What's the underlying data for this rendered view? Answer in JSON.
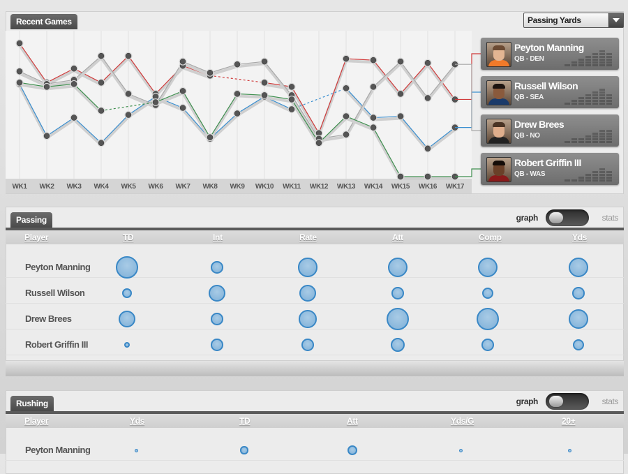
{
  "recent_games": {
    "title": "Recent Games",
    "stat_select": {
      "selected": "Passing Yards"
    },
    "weeks": [
      "WK1",
      "WK2",
      "WK3",
      "WK4",
      "WK5",
      "WK6",
      "WK7",
      "WK8",
      "WK9",
      "WK10",
      "WK11",
      "WK12",
      "WK13",
      "WK14",
      "WK15",
      "WK16",
      "WK17"
    ],
    "colors": {
      "manning": "#d03a3a",
      "wilson": "#3a8fd0",
      "brees": "#a8a8a8",
      "griffin": "#3f8f4f"
    },
    "players": [
      {
        "name": "Peyton Manning",
        "team": "QB - DEN",
        "icon": "player-photo-icon"
      },
      {
        "name": "Russell Wilson",
        "team": "QB - SEA",
        "icon": "player-photo-icon"
      },
      {
        "name": "Drew Brees",
        "team": "QB - NO",
        "icon": "player-photo-icon"
      },
      {
        "name": "Robert Griffin III",
        "team": "QB - WAS",
        "icon": "player-photo-icon"
      }
    ]
  },
  "chart_data": {
    "type": "line",
    "categories": [
      "WK1",
      "WK2",
      "WK3",
      "WK4",
      "WK5",
      "WK6",
      "WK7",
      "WK8",
      "WK9",
      "WK10",
      "WK11",
      "WK12",
      "WK13",
      "WK14",
      "WK15",
      "WK16",
      "WK17"
    ],
    "ylim": [
      0,
      1
    ],
    "series": [
      {
        "name": "Peyton Manning",
        "values": [
          0.95,
          0.67,
          0.77,
          0.67,
          0.86,
          0.59,
          0.79,
          0.72,
          null,
          0.67,
          0.64,
          0.31,
          0.84,
          0.83,
          0.59,
          0.81,
          0.55
        ]
      },
      {
        "name": "Russell Wilson",
        "values": [
          0.66,
          0.29,
          0.42,
          0.24,
          0.44,
          0.57,
          0.49,
          0.27,
          0.45,
          0.57,
          0.48,
          null,
          0.63,
          0.42,
          0.43,
          0.2,
          0.35
        ]
      },
      {
        "name": "Drew Brees",
        "values": [
          0.75,
          0.66,
          0.69,
          0.86,
          0.59,
          0.51,
          0.82,
          0.74,
          0.8,
          0.82,
          0.58,
          0.27,
          0.3,
          0.64,
          0.82,
          0.56,
          0.8
        ]
      },
      {
        "name": "Robert Griffin III",
        "values": [
          0.67,
          0.64,
          0.66,
          0.47,
          null,
          0.53,
          0.61,
          0.28,
          0.59,
          0.58,
          0.55,
          0.24,
          0.43,
          0.35,
          0.0,
          0.0,
          0.0
        ]
      }
    ],
    "dashed_segments": [
      {
        "series": "Peyton Manning",
        "from": "WK8",
        "to": "WK10"
      },
      {
        "series": "Russell Wilson",
        "from": "WK11",
        "to": "WK13"
      },
      {
        "series": "Robert Griffin III",
        "from": "WK4",
        "to": "WK6"
      }
    ]
  },
  "passing": {
    "title": "Passing",
    "toggle": {
      "left": "graph",
      "right": "stats",
      "selected": "graph"
    },
    "columns": [
      "Player",
      "TD",
      "Int",
      "Rate",
      "Att",
      "Comp",
      "Yds"
    ],
    "rows": [
      {
        "player": "Peyton Manning",
        "values": [
          1.0,
          0.55,
          0.85,
          0.9,
          0.9,
          0.9
        ]
      },
      {
        "player": "Russell Wilson",
        "values": [
          0.45,
          0.75,
          0.75,
          0.55,
          0.5,
          0.55
        ]
      },
      {
        "player": "Drew Brees",
        "values": [
          0.75,
          0.55,
          0.8,
          1.0,
          1.0,
          0.9
        ]
      },
      {
        "player": "Robert Griffin III",
        "values": [
          0.25,
          0.55,
          0.55,
          0.65,
          0.55,
          0.5
        ]
      }
    ]
  },
  "rushing": {
    "title": "Rushing",
    "toggle": {
      "left": "graph",
      "right": "stats",
      "selected": "graph"
    },
    "columns": [
      "Player",
      "Yds",
      "TD",
      "Att",
      "Yds/G",
      "20+"
    ],
    "rows": [
      {
        "player": "Peyton Manning",
        "values": [
          0.15,
          0.35,
          0.45,
          0.15,
          0.15
        ]
      }
    ]
  }
}
